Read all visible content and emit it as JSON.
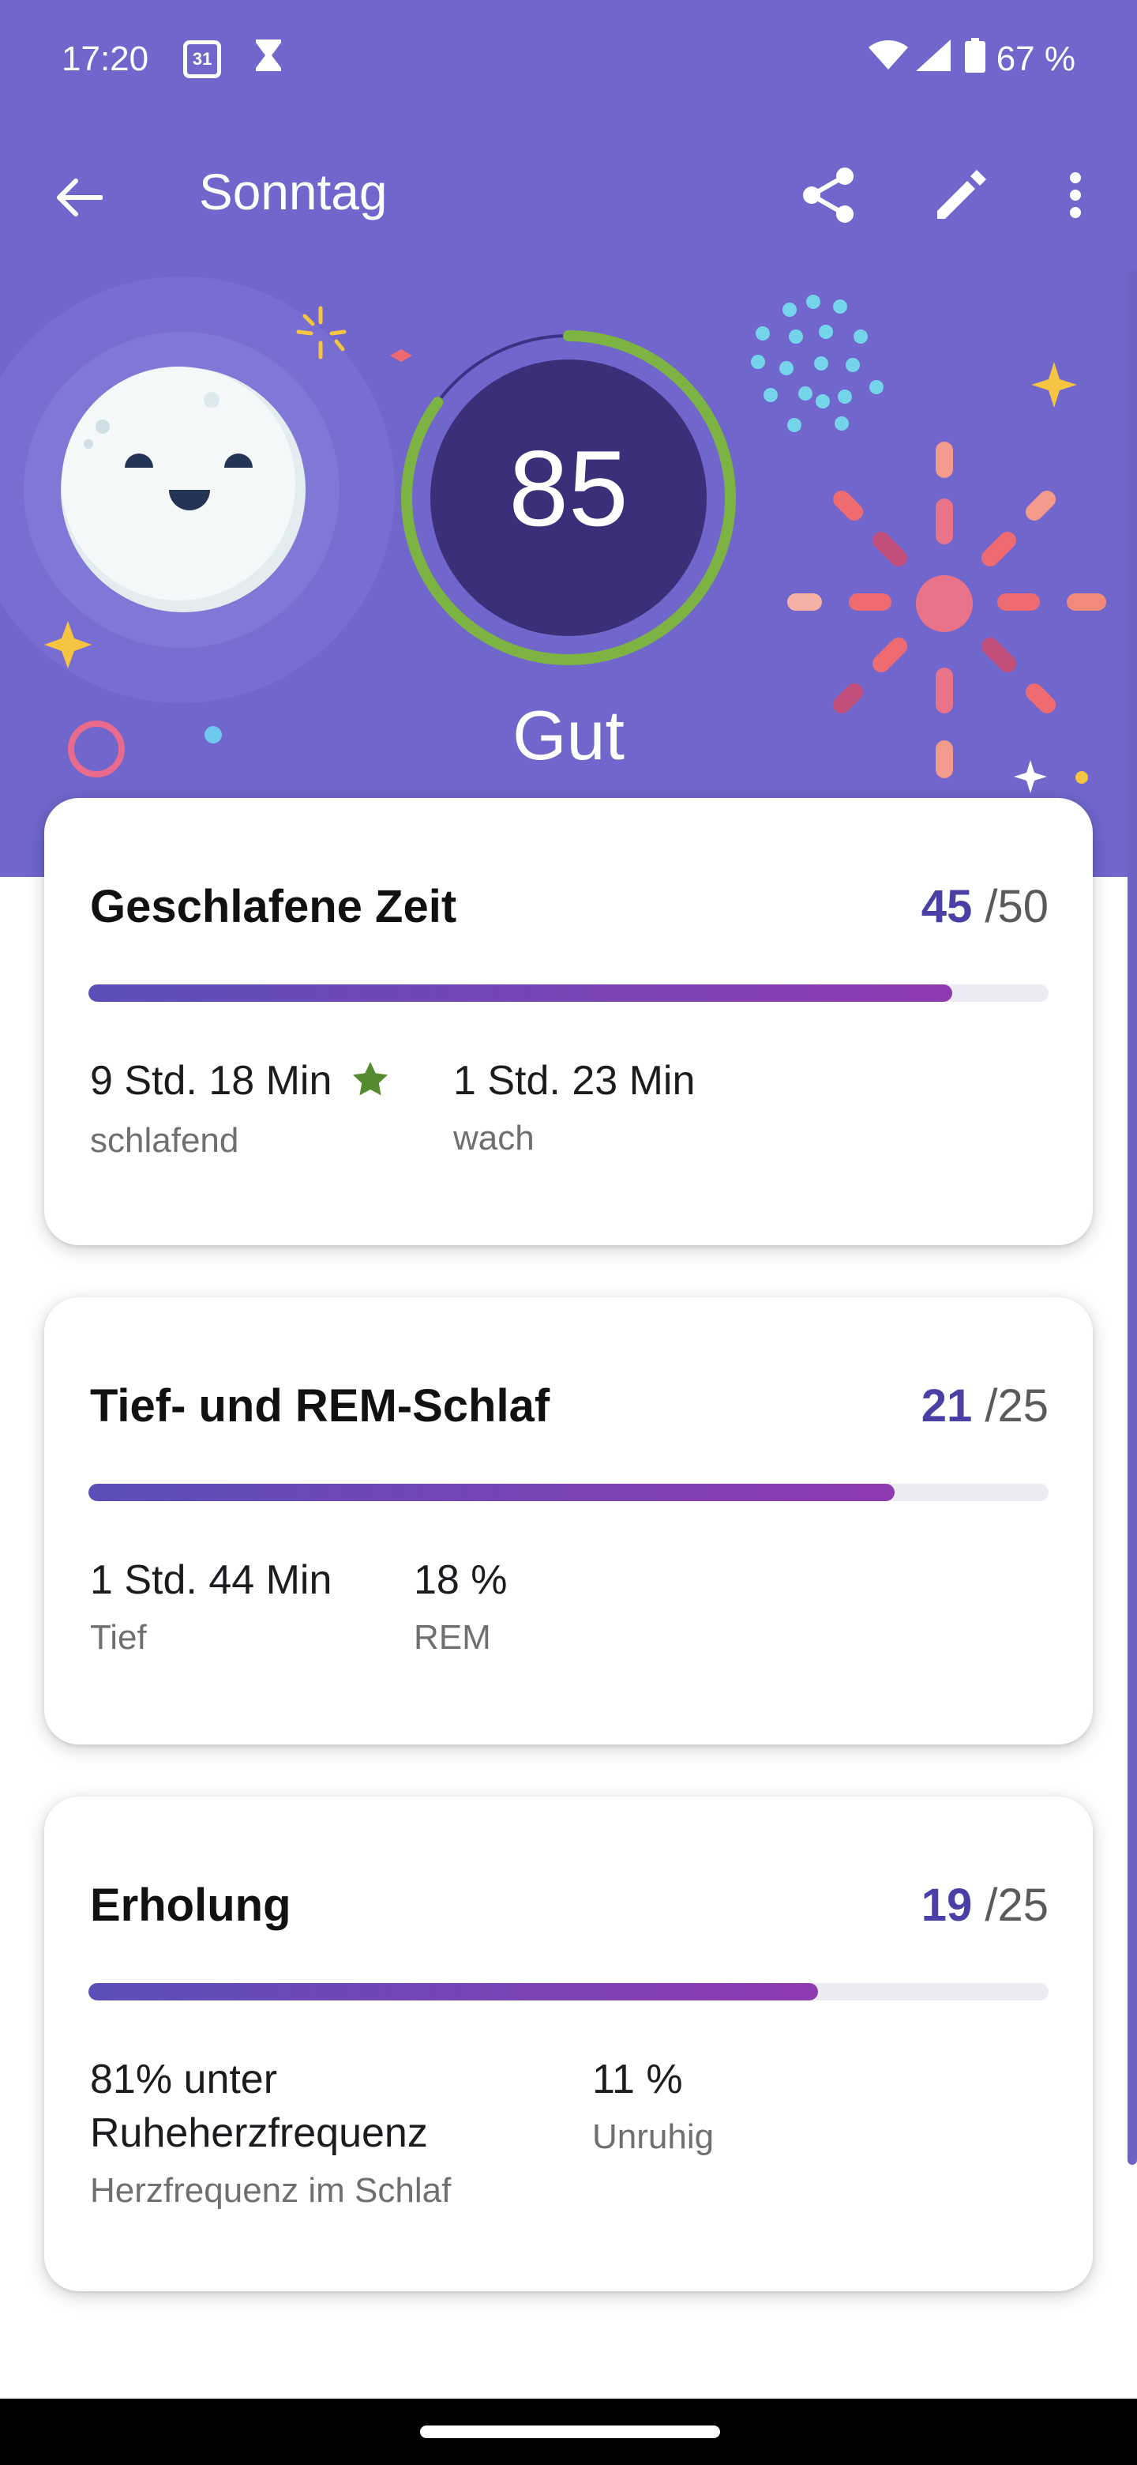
{
  "status_bar": {
    "time": "17:20",
    "calendar_day": "31",
    "battery": "67 %"
  },
  "app_bar": {
    "title": "Sonntag"
  },
  "score": {
    "value": "85",
    "fraction": 0.85,
    "label": "Gut",
    "ring_color": "#7cb342"
  },
  "cards": [
    {
      "title": "Geschlafene Zeit",
      "points": "45",
      "max": "/50",
      "progress": 0.9,
      "metrics": [
        {
          "value": "9 Std. 18 Min",
          "label": "schlafend",
          "icon": "star-icon"
        },
        {
          "value": "1 Std. 23 Min",
          "label": "wach"
        }
      ]
    },
    {
      "title": "Tief- und REM-Schlaf",
      "points": "21",
      "max": "/25",
      "progress": 0.84,
      "metrics": [
        {
          "value": "1 Std. 44 Min",
          "label": "Tief"
        },
        {
          "value": "18 %",
          "label": "REM"
        }
      ]
    },
    {
      "title": "Erholung",
      "points": "19",
      "max": "/25",
      "progress": 0.76,
      "metrics": [
        {
          "value_line1": "81% unter",
          "value_line2": "Ruheherzfrequenz",
          "label": "Herzfrequenz im Schlaf"
        },
        {
          "value": "11 %",
          "label": "Unruhig"
        }
      ]
    }
  ],
  "colors": {
    "header": "#7066cc",
    "accent": "#4a3fa4",
    "star": "#558b2f"
  }
}
